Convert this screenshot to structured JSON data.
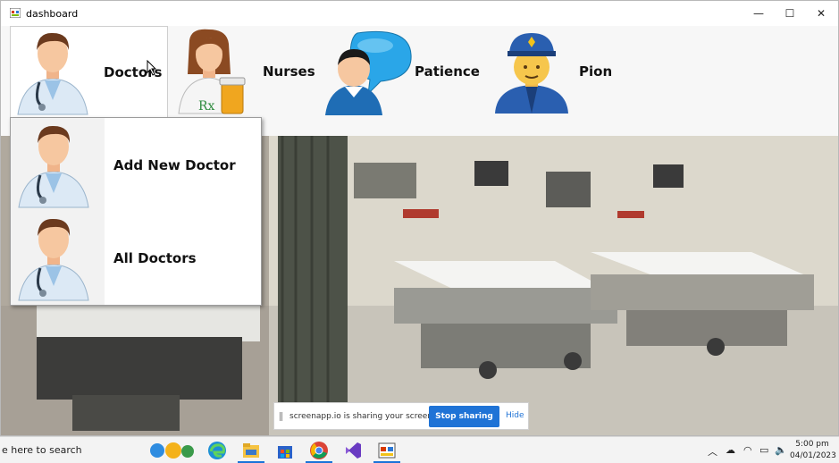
{
  "window": {
    "title": "dashboard",
    "controls": {
      "minimize": "—",
      "maximize": "☐",
      "close": "✕"
    }
  },
  "menu": {
    "items": [
      {
        "label": "Doctors",
        "icon": "doctor-icon"
      },
      {
        "label": "Nurses",
        "icon": "nurse-icon"
      },
      {
        "label": "Patience",
        "icon": "patient-chat-icon"
      },
      {
        "label": "Pion",
        "icon": "police-officer-icon"
      }
    ]
  },
  "dropdown": {
    "items": [
      {
        "label": "Add New Doctor",
        "icon": "doctor-icon"
      },
      {
        "label": "All Doctors",
        "icon": "doctor-icon"
      }
    ]
  },
  "sharebar": {
    "text": "screenapp.io is sharing your screen.",
    "stop_label": "Stop sharing",
    "hide_label": "Hide"
  },
  "taskbar": {
    "search_text": "e here to search",
    "clock_time": "5:00 pm",
    "clock_date": "04/01/2023",
    "apps": [
      "weather-icon",
      "edge-icon",
      "file-explorer-icon",
      "store-icon",
      "chrome-icon",
      "visual-studio-icon",
      "winforms-app-icon"
    ]
  },
  "colors": {
    "accent_blue": "#1f73d6",
    "doctor_coat": "#dce9f5"
  }
}
